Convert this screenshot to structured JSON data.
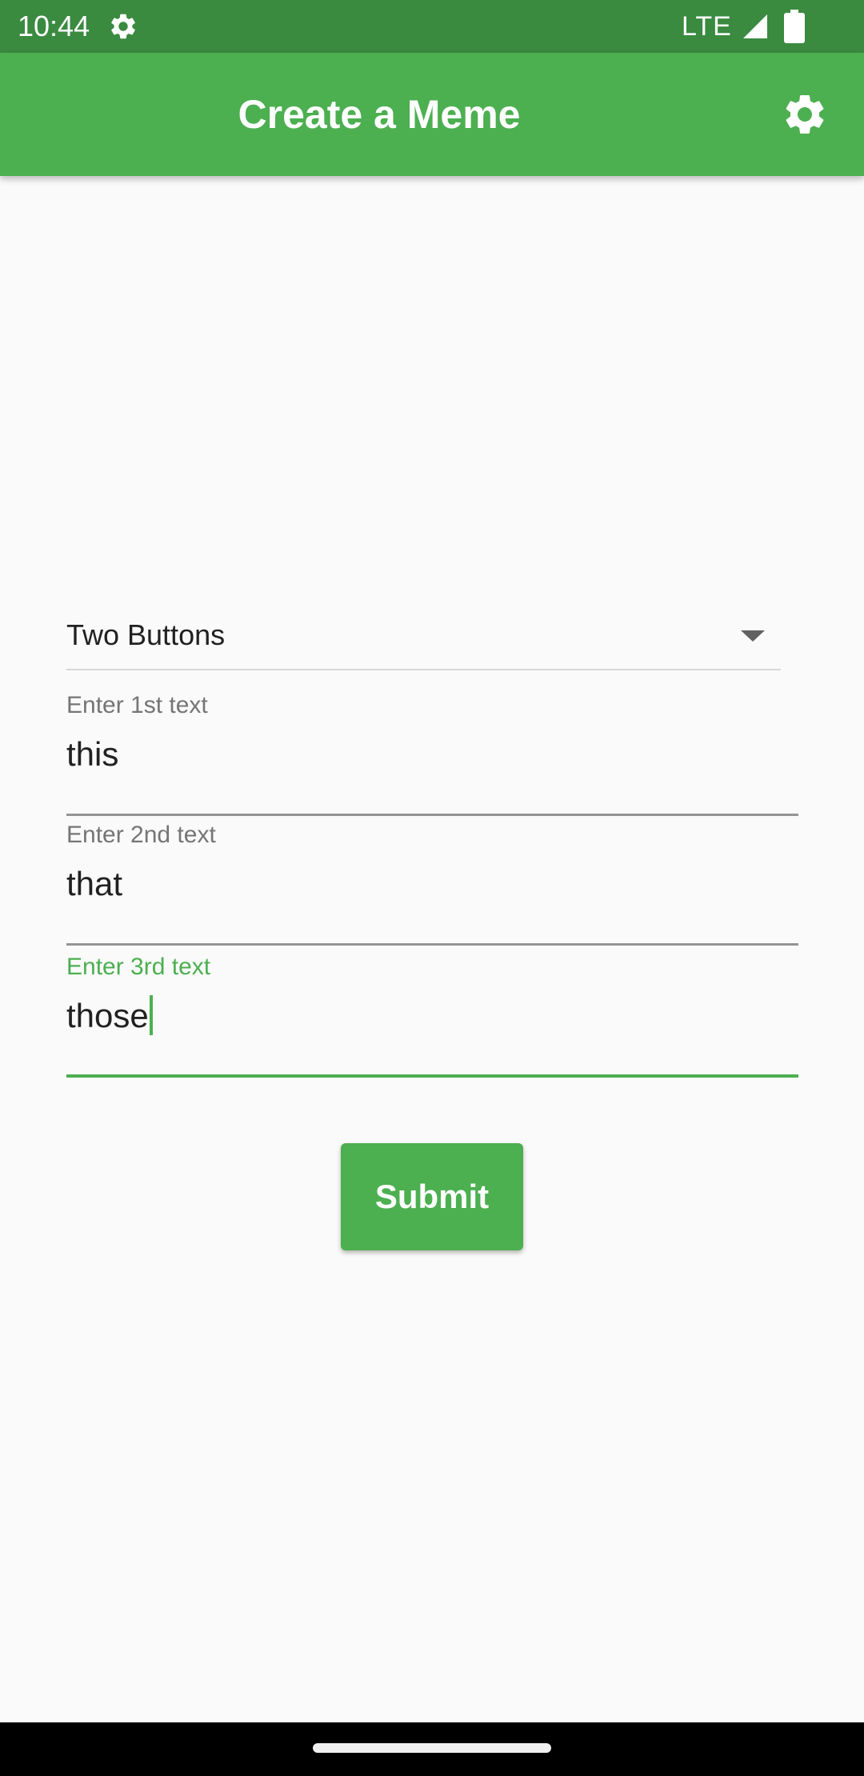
{
  "status_bar": {
    "time": "10:44",
    "network": "LTE",
    "icons": [
      "settings-gear-icon",
      "signal-icon",
      "battery-icon"
    ]
  },
  "app_bar": {
    "title": "Create a Meme",
    "action_icon": "settings-icon",
    "color": "#4caf50"
  },
  "form": {
    "template_dropdown": {
      "selected": "Two Buttons",
      "icon": "dropdown-arrow-icon"
    },
    "fields": [
      {
        "label": "Enter 1st text",
        "value": "this",
        "focused": false
      },
      {
        "label": "Enter 2nd text",
        "value": "that",
        "focused": false
      },
      {
        "label": "Enter 3rd text",
        "value": "those",
        "focused": true
      }
    ],
    "submit_label": "Submit"
  },
  "colors": {
    "status_bar": "#3a8a40",
    "accent": "#4caf50",
    "background": "#fafafa"
  }
}
